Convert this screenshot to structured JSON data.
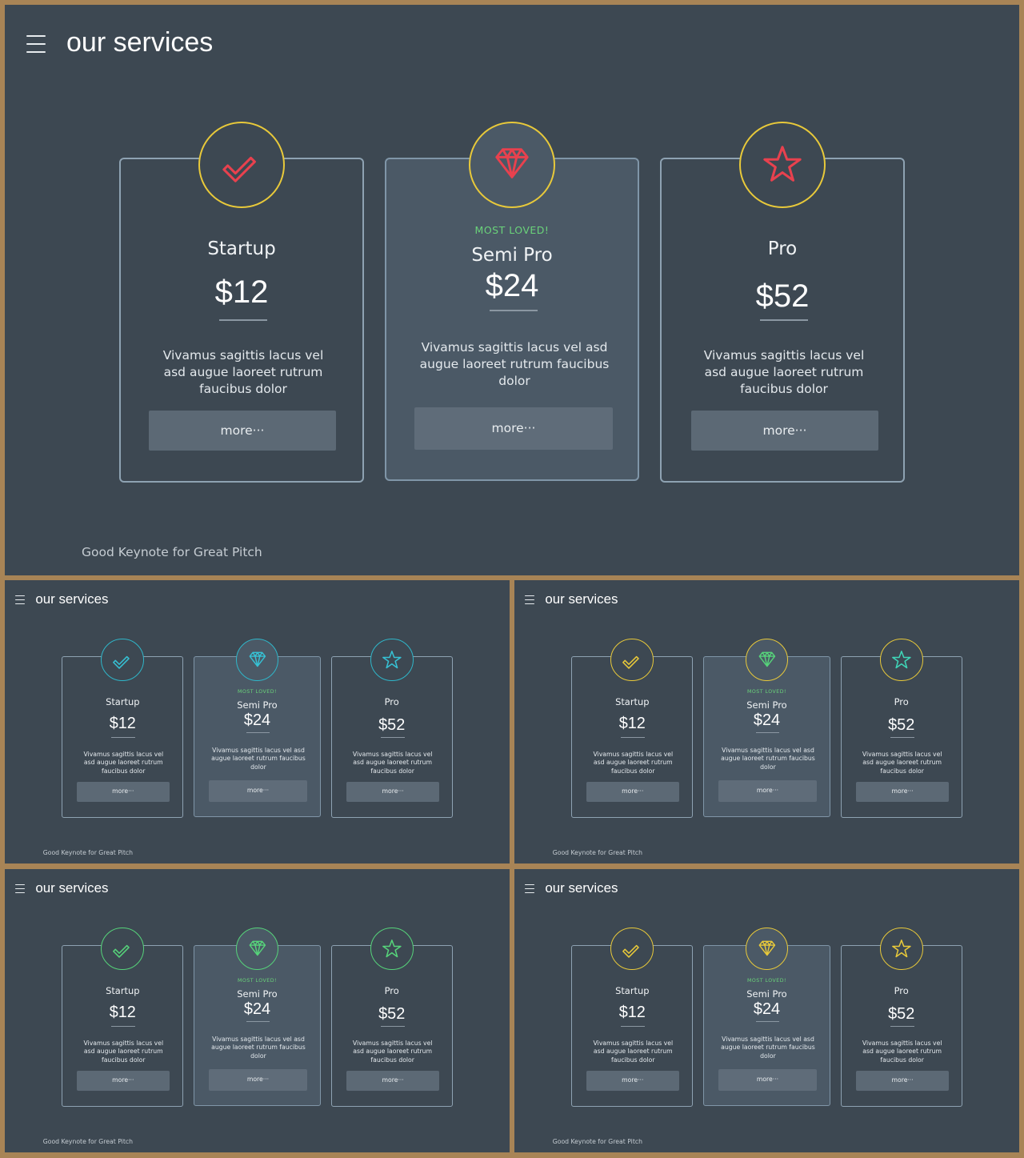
{
  "slides": [
    {
      "title": "our services",
      "footer": "Good Keynote for Great Pitch",
      "accent": {
        "circle": "#e8c93a",
        "startup_icon": "#e8414e",
        "semipro_icon": "#e8414e",
        "pro_icon": "#e8414e"
      }
    },
    {
      "title": "our services",
      "footer": "Good Keynote for Great Pitch",
      "accent": {
        "circle": "#2fb6c9",
        "startup_icon": "#36c1d4",
        "semipro_icon": "#36c1d4",
        "pro_icon": "#36c1d4"
      }
    },
    {
      "title": "our services",
      "footer": "Good Keynote for Great Pitch",
      "accent": {
        "circle": "#e8c93a",
        "startup_icon": "#e8c93a",
        "semipro_icon": "#56d37a",
        "pro_icon": "#3fd6b8"
      }
    },
    {
      "title": "our services",
      "footer": "Good Keynote for Great Pitch",
      "accent": {
        "circle": "#56d37a",
        "startup_icon": "#56d37a",
        "semipro_icon": "#56d37a",
        "pro_icon": "#56d37a"
      }
    },
    {
      "title": "our services",
      "footer": "Good Keynote for Great Pitch",
      "accent": {
        "circle": "#e8c93a",
        "startup_icon": "#e8c93a",
        "semipro_icon": "#e8c93a",
        "pro_icon": "#e8c93a"
      }
    }
  ],
  "plans": [
    {
      "icon": "checkmark-icon",
      "tag": "",
      "name": "Startup",
      "price": "$12",
      "description": "Vivamus sagittis lacus vel asd augue laoreet rutrum faucibus dolor",
      "button": "more···"
    },
    {
      "icon": "diamond-icon",
      "tag": "MOST LOVED!",
      "name": "Semi Pro",
      "price": "$24",
      "description": "Vivamus sagittis lacus vel asd augue laoreet rutrum faucibus dolor",
      "button": "more···"
    },
    {
      "icon": "star-icon",
      "tag": "",
      "name": "Pro",
      "price": "$52",
      "description": "Vivamus sagittis lacus vel asd augue laoreet rutrum faucibus dolor",
      "button": "more···"
    }
  ]
}
